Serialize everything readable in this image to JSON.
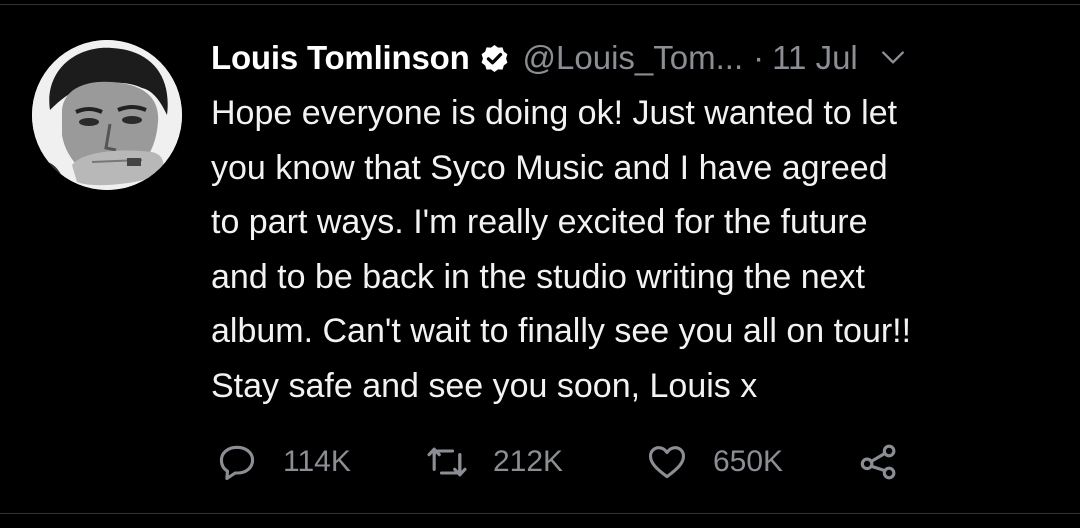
{
  "tweet": {
    "author_name": "Louis Tomlinson",
    "handle": "@Louis_Tom...",
    "separator": "·",
    "date": "11 Jul",
    "lines": [
      "Hope everyone is doing ok! Just wanted to let",
      "you know that Syco Music and I have agreed",
      "to part ways. I'm really excited for the future",
      "and to be back in the studio writing the next",
      "album. Can't wait to finally see you all on tour!!",
      "Stay safe and see you soon, Louis x"
    ],
    "verified": true
  },
  "actions": {
    "reply_count": "114K",
    "retweet_count": "212K",
    "like_count": "650K"
  },
  "icons": {
    "verified": "verified-badge-icon",
    "caret": "chevron-down-icon",
    "reply": "reply-icon",
    "retweet": "retweet-icon",
    "like": "heart-icon",
    "share": "share-icon"
  },
  "colors": {
    "background": "#000000",
    "text": "#f2f2f2",
    "muted": "#8b8f94",
    "divider": "#2f3336"
  }
}
